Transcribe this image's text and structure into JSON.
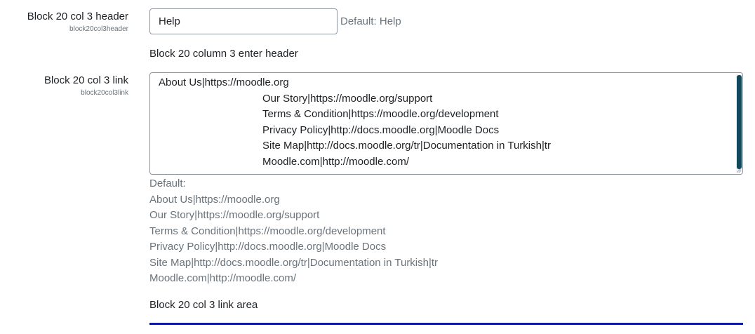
{
  "setting_header": {
    "title": "Block 20 col 3 header",
    "key": "block20col3header",
    "value": "Help",
    "default_text": "Default: Help",
    "description": "Block 20 column 3 enter header"
  },
  "setting_link": {
    "title": "Block 20 col 3 link",
    "key": "block20col3link",
    "lines": [
      "About Us|https://moodle.org",
      "Our Story|https://moodle.org/support",
      "Terms & Condition|https://moodle.org/development",
      "Privacy Policy|http://docs.moodle.org|Moodle Docs",
      "Site Map|http://docs.moodle.org/tr|Documentation in Turkish|tr",
      "Moodle.com|http://moodle.com/"
    ],
    "default_label": "Default:",
    "default_lines": [
      "About Us|https://moodle.org",
      "Our Story|https://moodle.org/support",
      "Terms & Condition|https://moodle.org/development",
      "Privacy Policy|http://docs.moodle.org|Moodle Docs",
      "Site Map|http://docs.moodle.org/tr|Documentation in Turkish|tr",
      "Moodle.com|http://moodle.com/"
    ],
    "description": "Block 20 col 3 link area"
  },
  "colors": {
    "scrollbar_thumb": "#11495c",
    "bottom_bar": "#0f1aa3"
  }
}
